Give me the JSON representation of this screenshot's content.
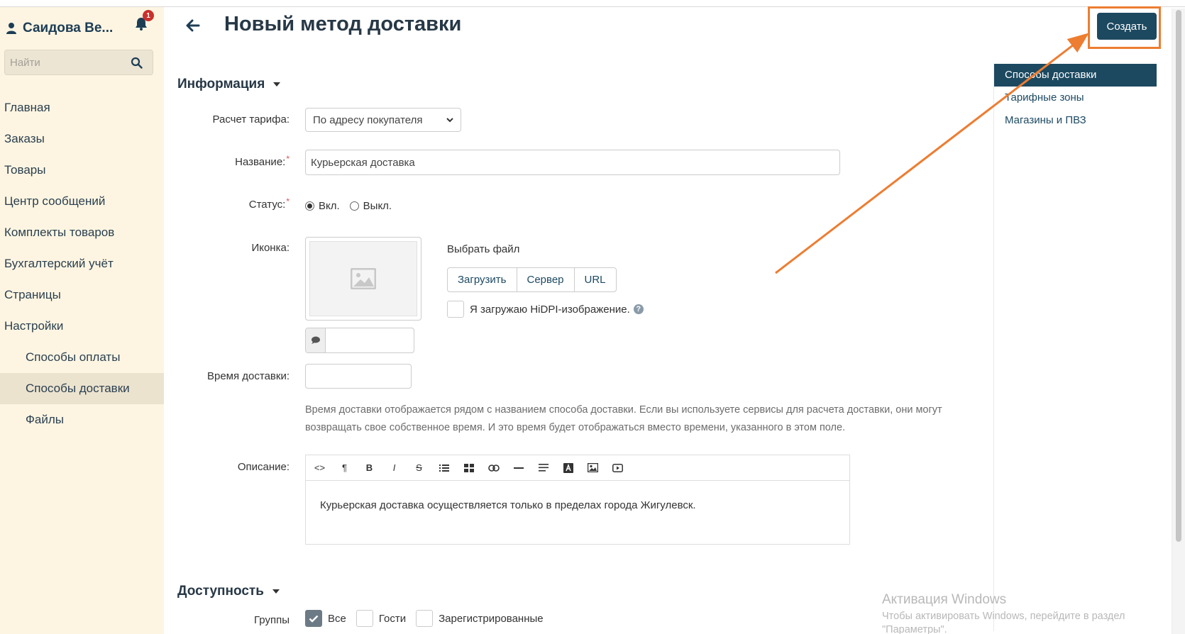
{
  "sidebar": {
    "user_name": "Саидова Ве...",
    "notification_count": "1",
    "search_placeholder": "Найти",
    "items": [
      {
        "label": "Главная"
      },
      {
        "label": "Заказы"
      },
      {
        "label": "Товары"
      },
      {
        "label": "Центр сообщений"
      },
      {
        "label": "Комплекты товаров"
      },
      {
        "label": "Бухгалтерский учёт"
      },
      {
        "label": "Страницы"
      },
      {
        "label": "Настройки"
      }
    ],
    "sub_items": [
      {
        "label": "Способы оплаты"
      },
      {
        "label": "Способы доставки",
        "active": true
      },
      {
        "label": "Файлы"
      }
    ]
  },
  "header": {
    "title": "Новый метод доставки",
    "create_label": "Создать"
  },
  "right_nav": {
    "items": [
      {
        "label": "Способы доставки",
        "active": true
      },
      {
        "label": "Тарифные зоны"
      },
      {
        "label": "Магазины и ПВЗ"
      }
    ]
  },
  "info_section": {
    "heading": "Информация",
    "tariff_label": "Расчет тарифа:",
    "tariff_value": "По адресу покупателя",
    "name_label": "Название:",
    "name_value": "Курьерская доставка",
    "status_label": "Статус:",
    "status_on": "Вкл.",
    "status_off": "Выкл.",
    "icon_label": "Иконка:",
    "choose_file": "Выбрать файл",
    "upload_buttons": [
      "Загрузить",
      "Сервер",
      "URL"
    ],
    "hidpi_label": "Я загружаю HiDPI-изображение.",
    "help_glyph": "?",
    "delivery_time_label": "Время доставки:",
    "delivery_time_value": "",
    "delivery_time_help": "Время доставки отображается рядом с названием способа доставки. Если вы используете сервисы для расчета доставки, они могут возвращать свое собственное время. И это время будет отображаться вместо времени, указанного в этом поле.",
    "description_label": "Описание:",
    "toolbar": [
      "<>",
      "¶",
      "B",
      "I",
      "S",
      "ul",
      "table",
      "link",
      "hr",
      "align",
      "A",
      "image",
      "video"
    ],
    "description_text": "Курьерская доставка осуществляется только в пределах города Жигулевск."
  },
  "availability_section": {
    "heading": "Доступность",
    "groups_label": "Группы",
    "groups": [
      {
        "label": "Все",
        "checked": true
      },
      {
        "label": "Гости",
        "checked": false
      },
      {
        "label": "Зарегистрированные",
        "checked": false
      }
    ]
  },
  "watermark": {
    "title": "Активация Windows",
    "line1": "Чтобы активировать Windows, перейдите в раздел",
    "line2": "\"Параметры\"."
  },
  "colors": {
    "primary": "#1c4960",
    "sidebar_bg": "#fdf5e2",
    "highlight": "#ed7d31"
  }
}
